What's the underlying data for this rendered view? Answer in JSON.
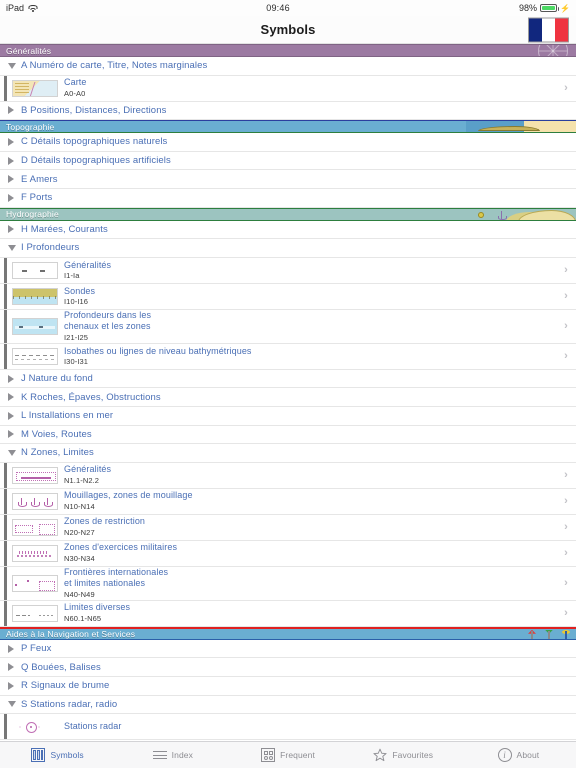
{
  "status_bar": {
    "device": "iPad",
    "wifi_icon": "wifi-icon",
    "time": "09:46",
    "battery_percent": "98%",
    "charging_icon": "lightning-bolt-icon"
  },
  "nav_bar": {
    "title": "Symbols",
    "language_button": {
      "name": "french-flag-button",
      "colors": [
        "#11277e",
        "#ffffff",
        "#ef3340"
      ]
    }
  },
  "sections": [
    {
      "id": "generalites",
      "header": "Généralités",
      "header_color": "#9c7aa2",
      "art": "compass-rose",
      "rows": [
        {
          "type": "category",
          "label": "A Numéro de carte, Titre, Notes marginales",
          "expanded": true,
          "triangle": "triangle-down-icon"
        },
        {
          "type": "symbol",
          "title": "Carte",
          "code": "A0-A0",
          "thumb": "th-carte",
          "lines": 1
        },
        {
          "type": "category",
          "label": "B Positions, Distances, Directions",
          "expanded": false,
          "triangle": "triangle-right-icon"
        }
      ]
    },
    {
      "id": "topographie",
      "header": "Topographie",
      "header_color": "#6aaed1",
      "art": "coastline-spit",
      "rows": [
        {
          "type": "category",
          "label": "C Détails topographiques naturels",
          "expanded": false,
          "triangle": "triangle-right-icon"
        },
        {
          "type": "category",
          "label": "D Détails topographiques artificiels",
          "expanded": false,
          "triangle": "triangle-right-icon"
        },
        {
          "type": "category",
          "label": "E Amers",
          "expanded": false,
          "triangle": "triangle-right-icon"
        },
        {
          "type": "category",
          "label": "F Ports",
          "expanded": false,
          "triangle": "triangle-right-icon"
        }
      ]
    },
    {
      "id": "hydrographie",
      "header": "Hydrographie",
      "header_color": "#9cc4c0",
      "art": "island-buoy-anchor",
      "rows": [
        {
          "type": "category",
          "label": "H Marées, Courants",
          "expanded": false,
          "triangle": "triangle-right-icon"
        },
        {
          "type": "category",
          "label": "I Profondeurs",
          "expanded": true,
          "triangle": "triangle-down-icon"
        },
        {
          "type": "symbol",
          "title": "Généralités",
          "code": "I1-Ia",
          "thumb": "th-gen1",
          "lines": 1
        },
        {
          "type": "symbol",
          "title": "Sondes",
          "code": "I10-I16",
          "thumb": "th-sondes",
          "lines": 1
        },
        {
          "type": "symbol",
          "title": "Profondeurs dans les chenaux et les zones",
          "code": "I21-I25",
          "thumb": "th-prof",
          "lines": 2,
          "line1": "Profondeurs dans les",
          "line2": "chenaux et les zones"
        },
        {
          "type": "symbol",
          "title": "Isobathes ou lignes de niveau bathymétriques",
          "code": "I30-I31",
          "thumb": "th-iso",
          "lines": 1
        },
        {
          "type": "category",
          "label": "J Nature du fond",
          "expanded": false,
          "triangle": "triangle-right-icon"
        },
        {
          "type": "category",
          "label": "K Roches, Épaves, Obstructions",
          "expanded": false,
          "triangle": "triangle-right-icon"
        },
        {
          "type": "category",
          "label": "L Installations en mer",
          "expanded": false,
          "triangle": "triangle-right-icon"
        },
        {
          "type": "category",
          "label": "M Voies, Routes",
          "expanded": false,
          "triangle": "triangle-right-icon"
        },
        {
          "type": "category",
          "label": "N Zones, Limites",
          "expanded": true,
          "triangle": "triangle-down-icon"
        },
        {
          "type": "symbol",
          "title": "Généralités",
          "code": "N1.1-N2.2",
          "thumb": "th-ngen",
          "lines": 1
        },
        {
          "type": "symbol",
          "title": "Mouillages, zones de mouillage",
          "code": "N10-N14",
          "thumb": "th-mouil",
          "lines": 1
        },
        {
          "type": "symbol",
          "title": "Zones de restriction",
          "code": "N20-N27",
          "thumb": "th-restr",
          "lines": 1
        },
        {
          "type": "symbol",
          "title": "Zones d'exercices militaires",
          "code": "N30-N34",
          "thumb": "th-mil",
          "lines": 1
        },
        {
          "type": "symbol",
          "title": "Frontières internationales et limites nationales",
          "code": "N40-N49",
          "thumb": "th-front",
          "lines": 2,
          "line1": "Frontières internationales",
          "line2": "et limites nationales"
        },
        {
          "type": "symbol",
          "title": "Limites diverses",
          "code": "N60.1-N65",
          "thumb": "th-lim",
          "lines": 1
        }
      ]
    },
    {
      "id": "aides",
      "header": "Aides à la Navigation et Services",
      "header_color": "#6aaed1",
      "art": "beacons",
      "rows": [
        {
          "type": "category",
          "label": "P Feux",
          "expanded": false,
          "triangle": "triangle-right-icon"
        },
        {
          "type": "category",
          "label": "Q Bouées, Balises",
          "expanded": false,
          "triangle": "triangle-right-icon"
        },
        {
          "type": "category",
          "label": "R Signaux de brume",
          "expanded": false,
          "triangle": "triangle-right-icon"
        },
        {
          "type": "category",
          "label": "S Stations radar, radio",
          "expanded": true,
          "triangle": "triangle-down-icon"
        },
        {
          "type": "symbol",
          "title": "Stations radar",
          "code": "",
          "thumb": "th-radar",
          "lines": 1
        }
      ]
    }
  ],
  "tab_bar": {
    "tabs": [
      {
        "label": "Symbols",
        "icon": "symbols-grid-icon",
        "active": true
      },
      {
        "label": "Index",
        "icon": "list-lines-icon",
        "active": false
      },
      {
        "label": "Frequent",
        "icon": "frequent-grid-icon",
        "active": false
      },
      {
        "label": "Favourites",
        "icon": "star-icon",
        "active": false
      },
      {
        "label": "About",
        "icon": "info-circle-icon",
        "active": false
      }
    ]
  },
  "disclosure_icon": "chevron-right-icon"
}
